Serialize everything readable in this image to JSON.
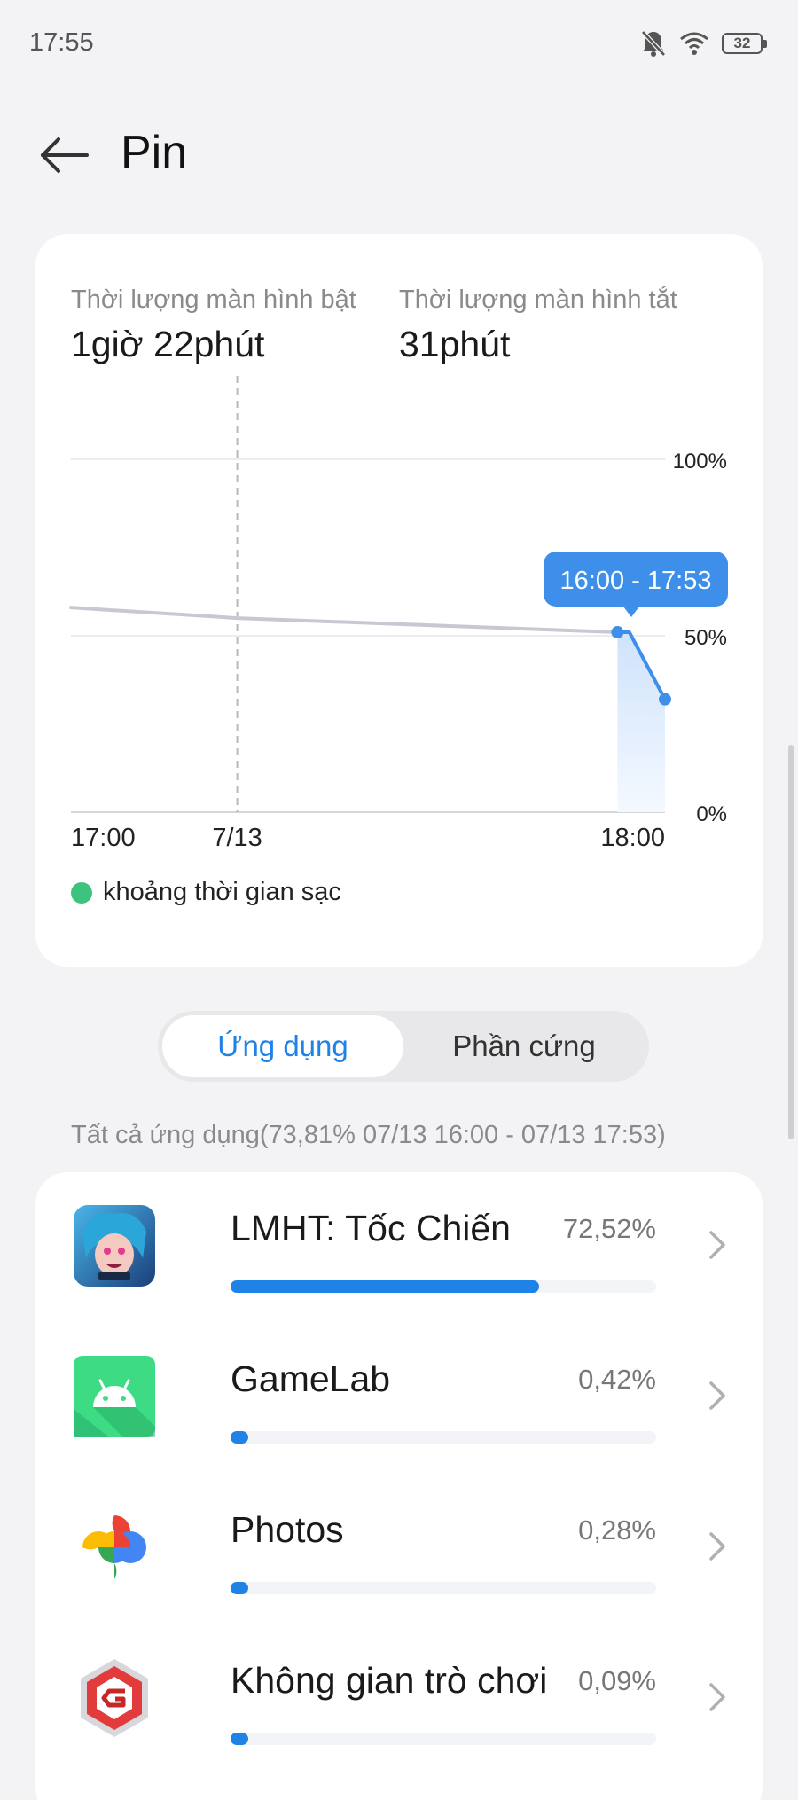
{
  "status_bar": {
    "time": "17:55",
    "battery": "32"
  },
  "header": {
    "title": "Pin"
  },
  "summary": {
    "screen_on_label": "Thời lượng màn hình bật",
    "screen_on_value": "1giờ 22phút",
    "screen_off_label": "Thời lượng màn hình tắt",
    "screen_off_value": "31phút"
  },
  "chart_data": {
    "type": "line",
    "x_labels": [
      "17:00",
      "7/13",
      "18:00"
    ],
    "y_labels": [
      "100%",
      "50%",
      "0%"
    ],
    "ylim": [
      0,
      100
    ],
    "series": [
      {
        "points": [
          [
            0.0,
            58
          ],
          [
            0.28,
            55
          ],
          [
            0.92,
            51
          ],
          [
            0.94,
            51
          ],
          [
            1.0,
            32
          ]
        ]
      }
    ],
    "highlight_range": [
      0.92,
      1.0
    ],
    "tooltip": "16:00 - 17:53",
    "legend": "khoảng thời gian sạc",
    "colors": {
      "line": "#c8c8d2",
      "highlight": "#3e8fea",
      "charging": "#3ec37f"
    }
  },
  "tabs": [
    {
      "label": "Ứng dụng",
      "active": true
    },
    {
      "label": "Phần cứng",
      "active": false
    }
  ],
  "caption": "Tất cả ứng dụng(73,81% 07/13 16:00 - 07/13 17:53)",
  "apps": [
    {
      "name": "LMHT: Tốc Chiến",
      "percent_label": "72,52%",
      "percent": 72.52
    },
    {
      "name": "GameLab",
      "percent_label": "0,42%",
      "percent": 0.42
    },
    {
      "name": "Photos",
      "percent_label": "0,28%",
      "percent": 0.28
    },
    {
      "name": "Không gian trò chơi",
      "percent_label": "0,09%",
      "percent": 0.09
    }
  ]
}
